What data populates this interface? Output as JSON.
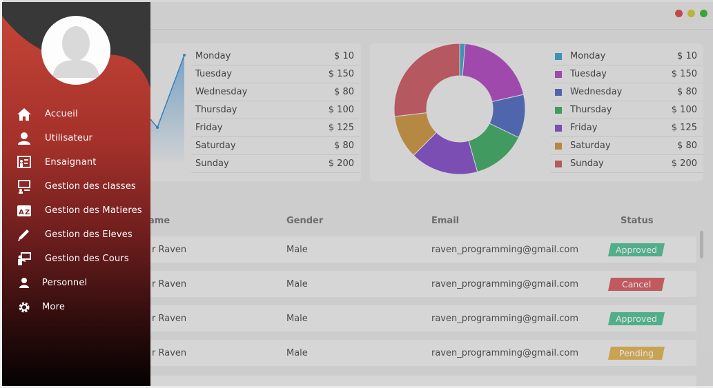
{
  "window": {
    "controls": [
      "close",
      "minimize",
      "maximize"
    ],
    "control_colors": [
      "#e0443e",
      "#dec23a",
      "#1ca534"
    ]
  },
  "sidebar": {
    "items": [
      {
        "label": "Accueil",
        "icon": "home-icon"
      },
      {
        "label": "Utilisateur",
        "icon": "user-icon"
      },
      {
        "label": "Ensaignant",
        "icon": "teacher-board-icon"
      },
      {
        "label": "Gestion des classes",
        "icon": "classroom-icon"
      },
      {
        "label": "Gestion des Matieres",
        "icon": "az-icon"
      },
      {
        "label": "Gestion des Eleves",
        "icon": "pencil-icon"
      },
      {
        "label": "Gestion des Cours",
        "icon": "lecture-icon"
      },
      {
        "label": "Personnel",
        "icon": "person-icon"
      },
      {
        "label": "More",
        "icon": "gear-icon"
      }
    ]
  },
  "weekly": [
    {
      "day": "Monday",
      "amount": "$ 10",
      "value": 10,
      "color": "#4aa3c9"
    },
    {
      "day": "Tuesday",
      "amount": "$ 150",
      "value": 150,
      "color": "#b453c3"
    },
    {
      "day": "Wednesday",
      "amount": "$ 80",
      "value": 80,
      "color": "#5a73c2"
    },
    {
      "day": "Thursday",
      "amount": "$ 100",
      "value": 100,
      "color": "#49ad6c"
    },
    {
      "day": "Friday",
      "amount": "$ 125",
      "value": 125,
      "color": "#8a58c8"
    },
    {
      "day": "Saturday",
      "amount": "$ 80",
      "value": 80,
      "color": "#cc9a4c"
    },
    {
      "day": "Sunday",
      "amount": "$ 200",
      "value": 200,
      "color": "#cc636b"
    }
  ],
  "table": {
    "headers": [
      "ame",
      "Gender",
      "Email",
      "Status"
    ],
    "rows": [
      {
        "name": "r Raven",
        "gender": "Male",
        "email": "raven_programming@gmail.com",
        "status": "Approved",
        "status_color": "#5cc49b"
      },
      {
        "name": "r Raven",
        "gender": "Male",
        "email": "raven_programming@gmail.com",
        "status": "Cancel",
        "status_color": "#d8666b"
      },
      {
        "name": "r Raven",
        "gender": "Male",
        "email": "raven_programming@gmail.com",
        "status": "Approved",
        "status_color": "#5cc49b"
      },
      {
        "name": "r Raven",
        "gender": "Male",
        "email": "raven_programming@gmail.com",
        "status": "Pending",
        "status_color": "#e3b65e"
      }
    ]
  }
}
